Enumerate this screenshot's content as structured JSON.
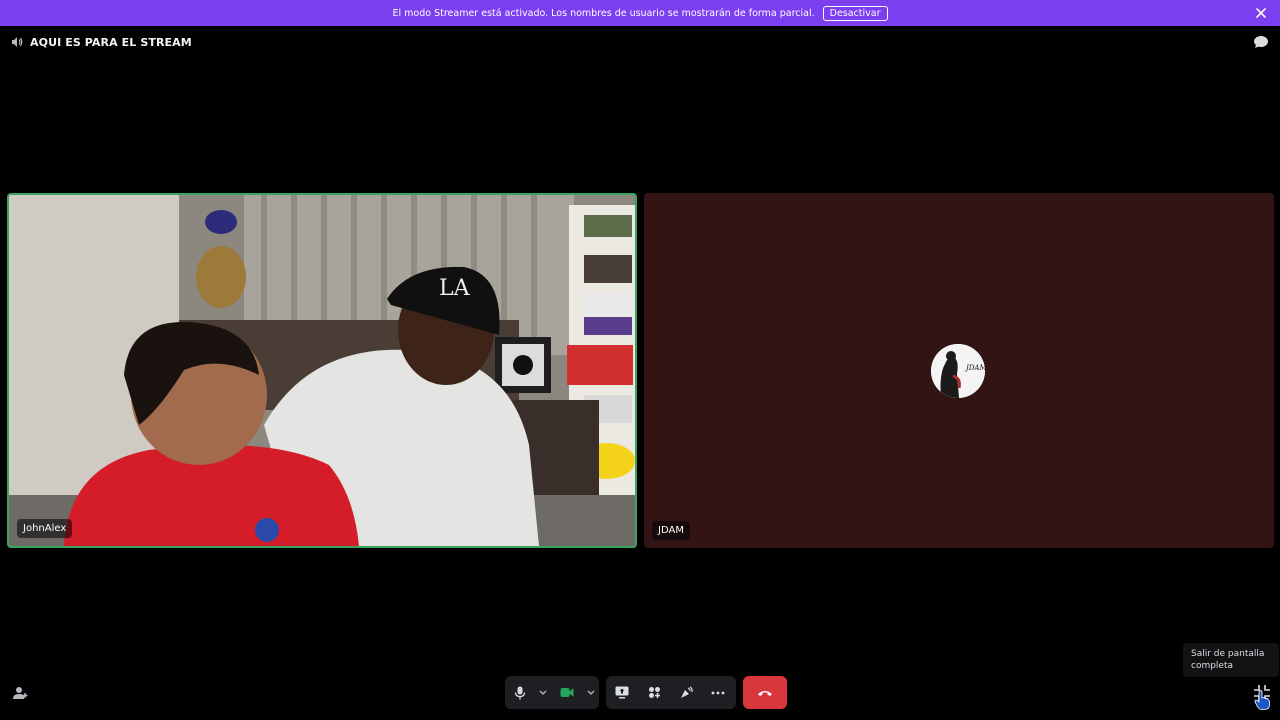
{
  "banner": {
    "text": "El modo Streamer está activado. Los nombres de usuario se mostrarán de forma parcial.",
    "button_label": "Desactivar",
    "color": "#7b3ff0"
  },
  "header": {
    "channel_title": "AQUI ES PARA EL STREAM",
    "channel_icon": "speaker-icon",
    "chat_icon": "chat-bubble-icon"
  },
  "participants": [
    {
      "name": "JohnAlex",
      "speaking": true,
      "video_on": true
    },
    {
      "name": "JDAM",
      "speaking": false,
      "video_on": false,
      "avatar_text": "JDAM"
    }
  ],
  "controls": {
    "mic_icon": "microphone-icon",
    "camera_icon": "camera-icon",
    "screenshare_icon": "screen-share-icon",
    "activities_icon": "activities-icon",
    "soundboard_icon": "soundboard-icon",
    "more_icon": "more-icon",
    "hangup_icon": "hangup-icon",
    "hangup_color": "#da373c",
    "camera_color": "#23a55a"
  },
  "tooltip": {
    "line1": "Salir de pantalla",
    "line2": "completa"
  },
  "colors": {
    "speaking_border": "#3ba55d",
    "no_video_bg": "#321414"
  }
}
